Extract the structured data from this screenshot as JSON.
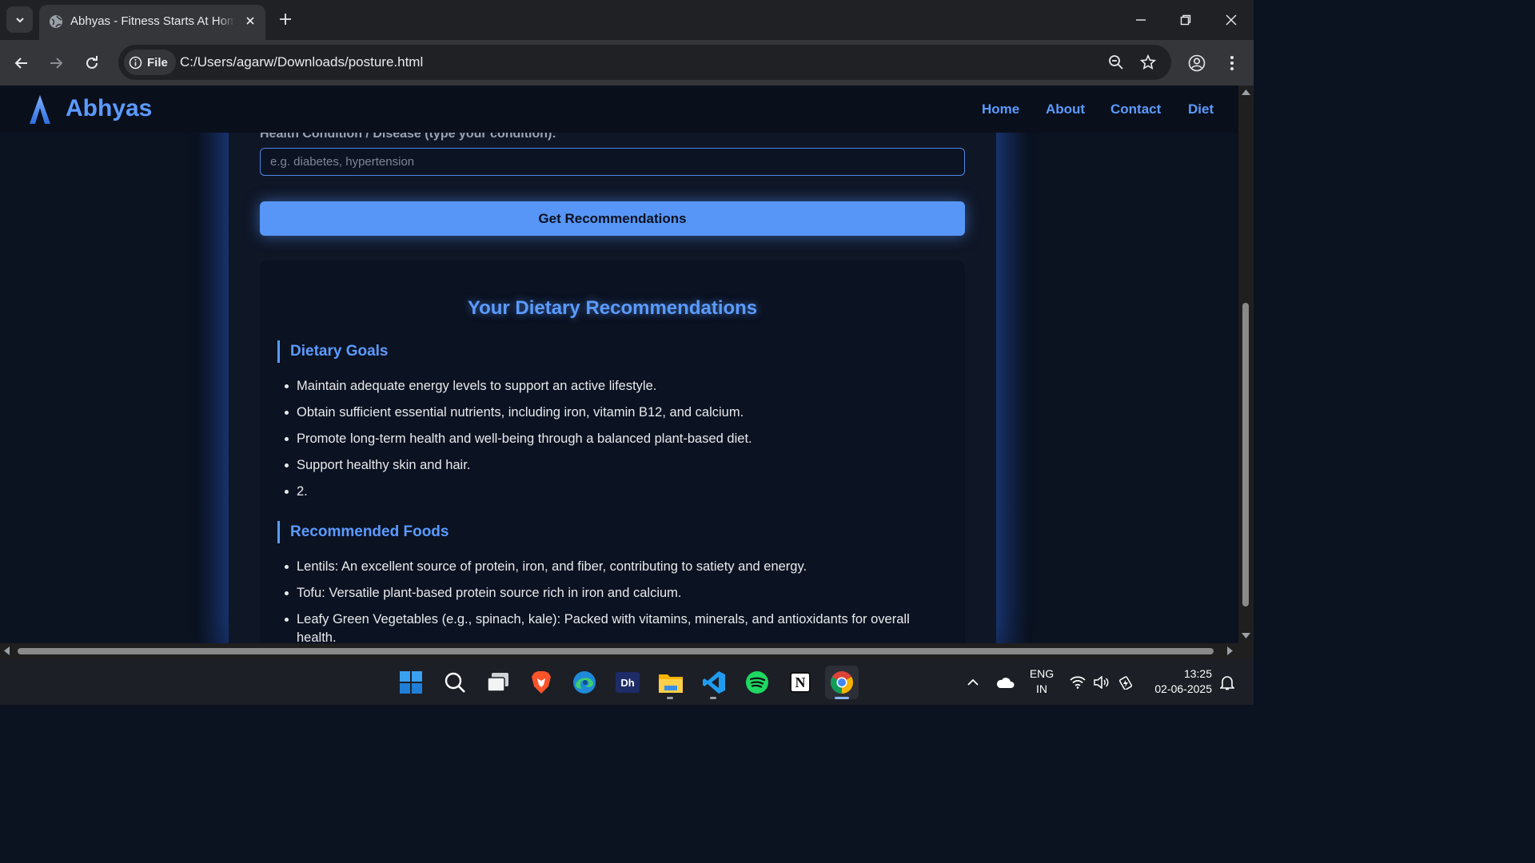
{
  "browser": {
    "tab_title": "Abhyas - Fitness Starts At Home",
    "omnibox_chip": "File",
    "url": "C:/Users/agarw/Downloads/posture.html"
  },
  "site": {
    "brand": "Abhyas",
    "nav": [
      "Home",
      "About",
      "Contact",
      "Diet"
    ]
  },
  "form": {
    "condition_label": "Health Condition / Disease (type your condition):",
    "condition_placeholder": "e.g. diabetes, hypertension",
    "submit_label": "Get Recommendations"
  },
  "recommendations": {
    "title": "Your Dietary Recommendations",
    "sections": [
      {
        "heading": "Dietary Goals",
        "items": [
          "Maintain adequate energy levels to support an active lifestyle.",
          "Obtain sufficient essential nutrients, including iron, vitamin B12, and calcium.",
          "Promote long-term health and well-being through a balanced plant-based diet.",
          "Support healthy skin and hair.",
          "2."
        ]
      },
      {
        "heading": "Recommended Foods",
        "items": [
          "Lentils: An excellent source of protein, iron, and fiber, contributing to satiety and energy.",
          "Tofu: Versatile plant-based protein source rich in iron and calcium.",
          "Leafy Green Vegetables (e.g., spinach, kale): Packed with vitamins, minerals, and antioxidants for overall health."
        ]
      }
    ]
  },
  "taskbar": {
    "apps": [
      "start-icon",
      "search-icon",
      "task-view-icon",
      "brave-icon",
      "edge-icon",
      "dh-app-icon",
      "file-explorer-icon",
      "vscode-icon",
      "spotify-icon",
      "notion-icon",
      "chrome-icon"
    ],
    "dh_app_text": "Dh",
    "notion_letter": "N",
    "language": "ENG",
    "region": "IN",
    "time": "13:25",
    "date": "02-06-2025"
  },
  "colors": {
    "accent": "#5b9bff",
    "button": "#5796f7",
    "page_bg": "#0b1220"
  }
}
